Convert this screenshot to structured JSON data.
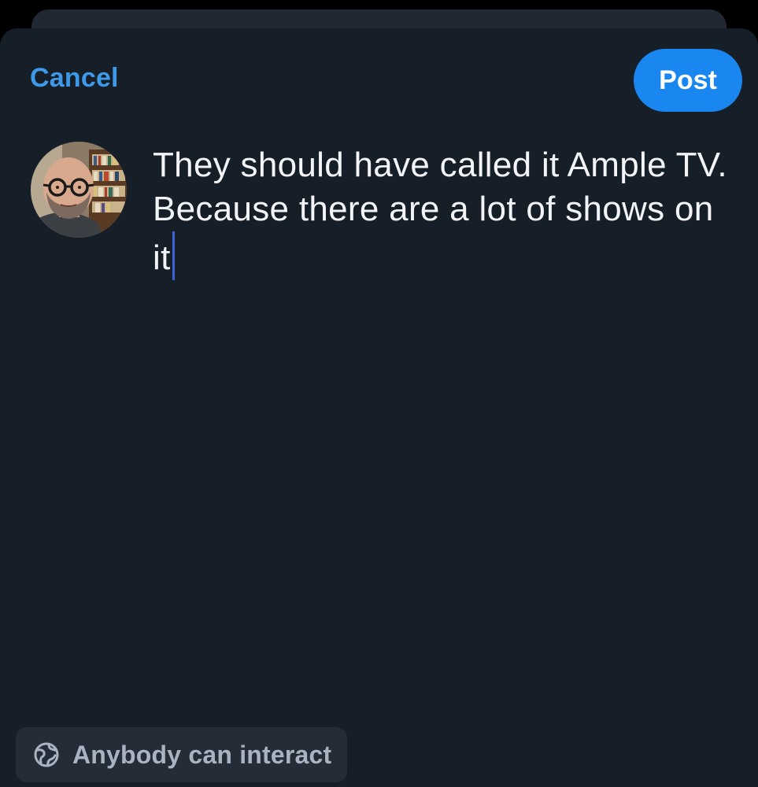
{
  "header": {
    "cancel_label": "Cancel",
    "post_label": "Post"
  },
  "composer": {
    "text": "They should have called it Ample TV. Because there are a lot of shows on it"
  },
  "footer": {
    "interaction_label": "Anybody can interact",
    "interaction_icon": "globe-icon"
  },
  "colors": {
    "accent": "#1a86f0",
    "link": "#3e99e8",
    "sheet_bg": "#161e27",
    "caret": "#3f63d6"
  }
}
